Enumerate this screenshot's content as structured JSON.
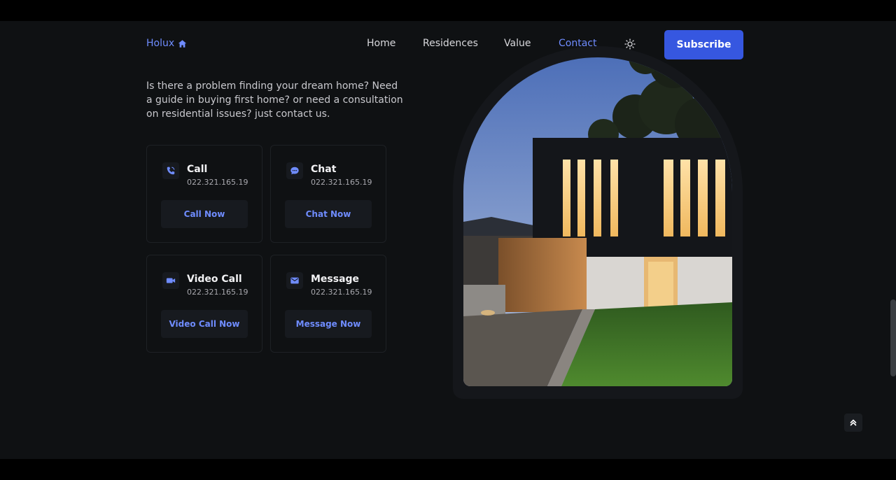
{
  "brand": {
    "name": "Holux",
    "accent": "#6f8cff",
    "button": "#3657e0"
  },
  "nav": {
    "items": [
      {
        "label": "Home"
      },
      {
        "label": "Residences"
      },
      {
        "label": "Value"
      },
      {
        "label": "Contact"
      }
    ],
    "active": "Contact",
    "theme_icon": "sun-icon",
    "subscribe_label": "Subscribe"
  },
  "contact": {
    "intro": "Is there a problem finding your dream home? Need a guide in buying first home? or need a consultation on residential issues? just contact us.",
    "cards": [
      {
        "icon": "phone-icon",
        "title": "Call",
        "number": "022.321.165.19",
        "action": "Call Now"
      },
      {
        "icon": "chat-icon",
        "title": "Chat",
        "number": "022.321.165.19",
        "action": "Chat Now"
      },
      {
        "icon": "video-camera-icon",
        "title": "Video Call",
        "number": "022.321.165.19",
        "action": "Video Call Now"
      },
      {
        "icon": "envelope-icon",
        "title": "Message",
        "number": "022.321.165.19",
        "action": "Message Now"
      }
    ]
  },
  "scroll_up_icon": "double-chevron-up-icon"
}
